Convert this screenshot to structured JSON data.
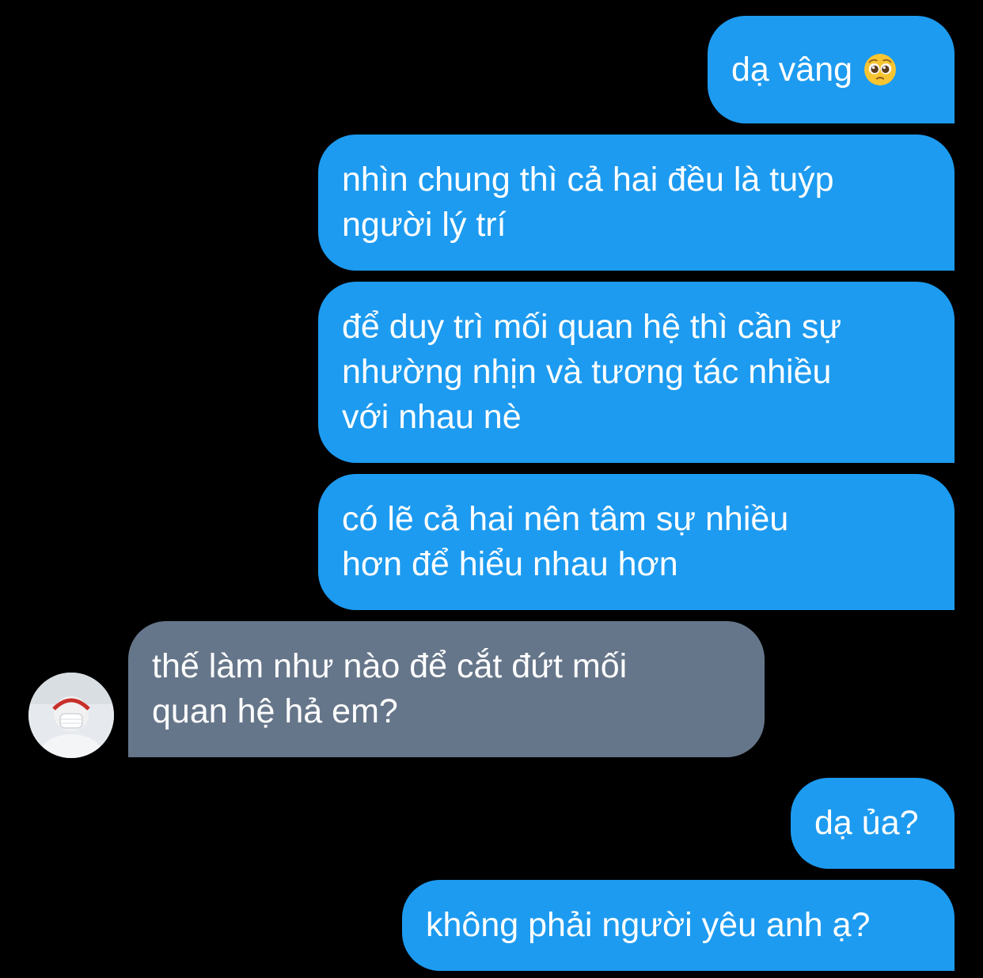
{
  "conversation": {
    "messages": [
      {
        "sender": "me",
        "text": "dạ vâng",
        "emoji": "pleading-face"
      },
      {
        "sender": "me",
        "text": "nhìn chung thì cả hai đều là tuýp\nngười lý trí"
      },
      {
        "sender": "me",
        "text": "để duy trì mối quan hệ thì cần sự\nnhường nhịn và tương tác nhiều\nvới nhau nè"
      },
      {
        "sender": "me",
        "text": "có lẽ cả hai nên tâm sự nhiều\nhơn để hiểu nhau hơn"
      },
      {
        "sender": "other",
        "text": "thế làm như nào để cắt đứt mối\nquan hệ hả em?"
      },
      {
        "sender": "me",
        "text": "dạ ủa?"
      },
      {
        "sender": "me",
        "text": "không phải người yêu anh ạ?"
      }
    ]
  },
  "colors": {
    "background": "#000000",
    "outgoing_bubble": "#1d9bf0",
    "incoming_bubble": "#66768a",
    "text": "#ffffff"
  },
  "icons": {
    "avatar": "contact-avatar",
    "emoji": "pleading-face-emoji"
  }
}
